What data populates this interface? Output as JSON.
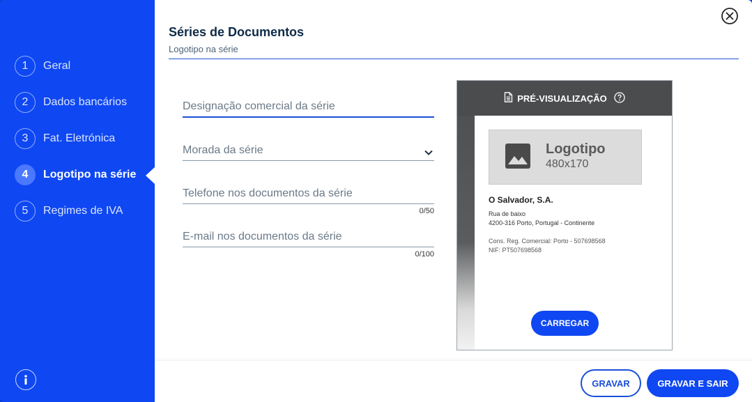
{
  "sidebar": {
    "steps": [
      {
        "num": "1",
        "label": "Geral"
      },
      {
        "num": "2",
        "label": "Dados bancários"
      },
      {
        "num": "3",
        "label": "Fat. Eletrónica"
      },
      {
        "num": "4",
        "label": "Logotipo na série"
      },
      {
        "num": "5",
        "label": "Regimes de IVA"
      }
    ],
    "active_step": "4"
  },
  "header": {
    "title": "Séries de Documentos",
    "subtitle": "Logotipo na série"
  },
  "form": {
    "designacao": {
      "placeholder": "Designação comercial da série",
      "value": ""
    },
    "morada": {
      "placeholder": "Morada da série"
    },
    "telefone": {
      "placeholder": "Telefone nos documentos da série",
      "counter": "0/50"
    },
    "email": {
      "placeholder": "E-mail nos documentos da série",
      "counter": "0/100"
    }
  },
  "preview": {
    "header_label": "PRÉ-VISUALIZAÇÃO",
    "logo_title": "Logotipo",
    "logo_dims": "480x170",
    "company_name": "O Salvador, S.A.",
    "address_line1": "Rua de baixo",
    "address_line2": "4200-316 Porto, Portugal - Continente",
    "reg_line": "Cons. Reg. Comercial: Porto - 507698568",
    "nif_line": "NIF: PT507698568",
    "upload_label": "CARREGAR"
  },
  "footer": {
    "save_label": "GRAVAR",
    "save_exit_label": "GRAVAR E SAIR"
  },
  "colors": {
    "sidebar_bg": "#0f47f2",
    "accent": "#1a4fd6",
    "title": "#0e2a47"
  }
}
